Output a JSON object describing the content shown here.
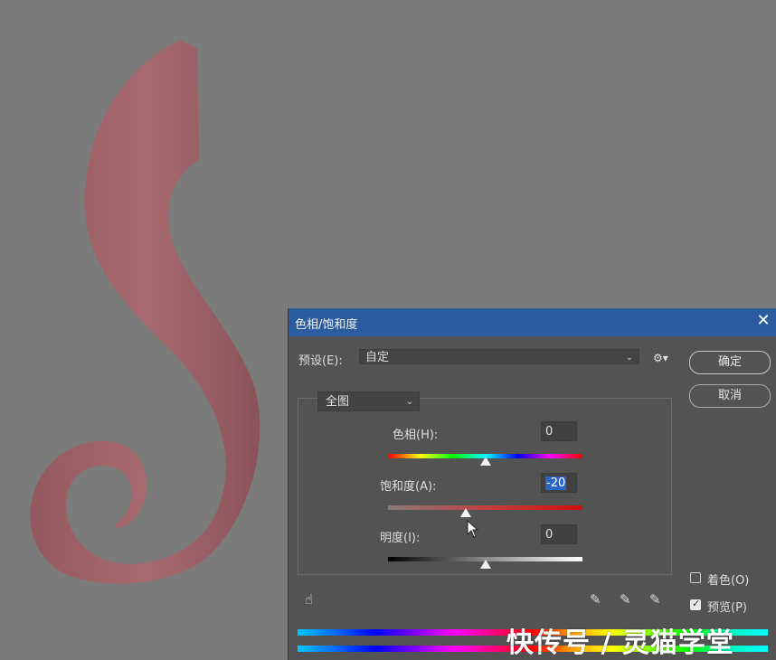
{
  "dialog": {
    "title": "色相/饱和度",
    "preset_label": "预设(E):",
    "preset_value": "自定",
    "ok_label": "确定",
    "cancel_label": "取消",
    "channel_value": "全图",
    "hue": {
      "label": "色相(H):",
      "value": "0",
      "slider_fraction": 0.5
    },
    "saturation": {
      "label": "饱和度(A):",
      "value": "-20",
      "slider_fraction": 0.4
    },
    "lightness": {
      "label": "明度(I):",
      "value": "0",
      "slider_fraction": 0.5
    },
    "colorize": {
      "label": "着色(O)",
      "checked": false
    },
    "preview": {
      "label": "预览(P)",
      "checked": true
    }
  },
  "icons": {
    "close": "close-icon",
    "gear": "gear-icon",
    "hand": "targeted-adjust-hand-icon",
    "eyedroppers": [
      "eyedropper-icon",
      "eyedropper-plus-icon",
      "eyedropper-minus-icon"
    ]
  },
  "colors": {
    "canvas_bg": "#7b7b7b",
    "shape_fill": "#a06468",
    "dialog_bg": "#535353",
    "titlebar_bg": "#2b5c9f",
    "highlight": "#2b66c4"
  },
  "watermark": "快传号 / 灵猫学堂"
}
